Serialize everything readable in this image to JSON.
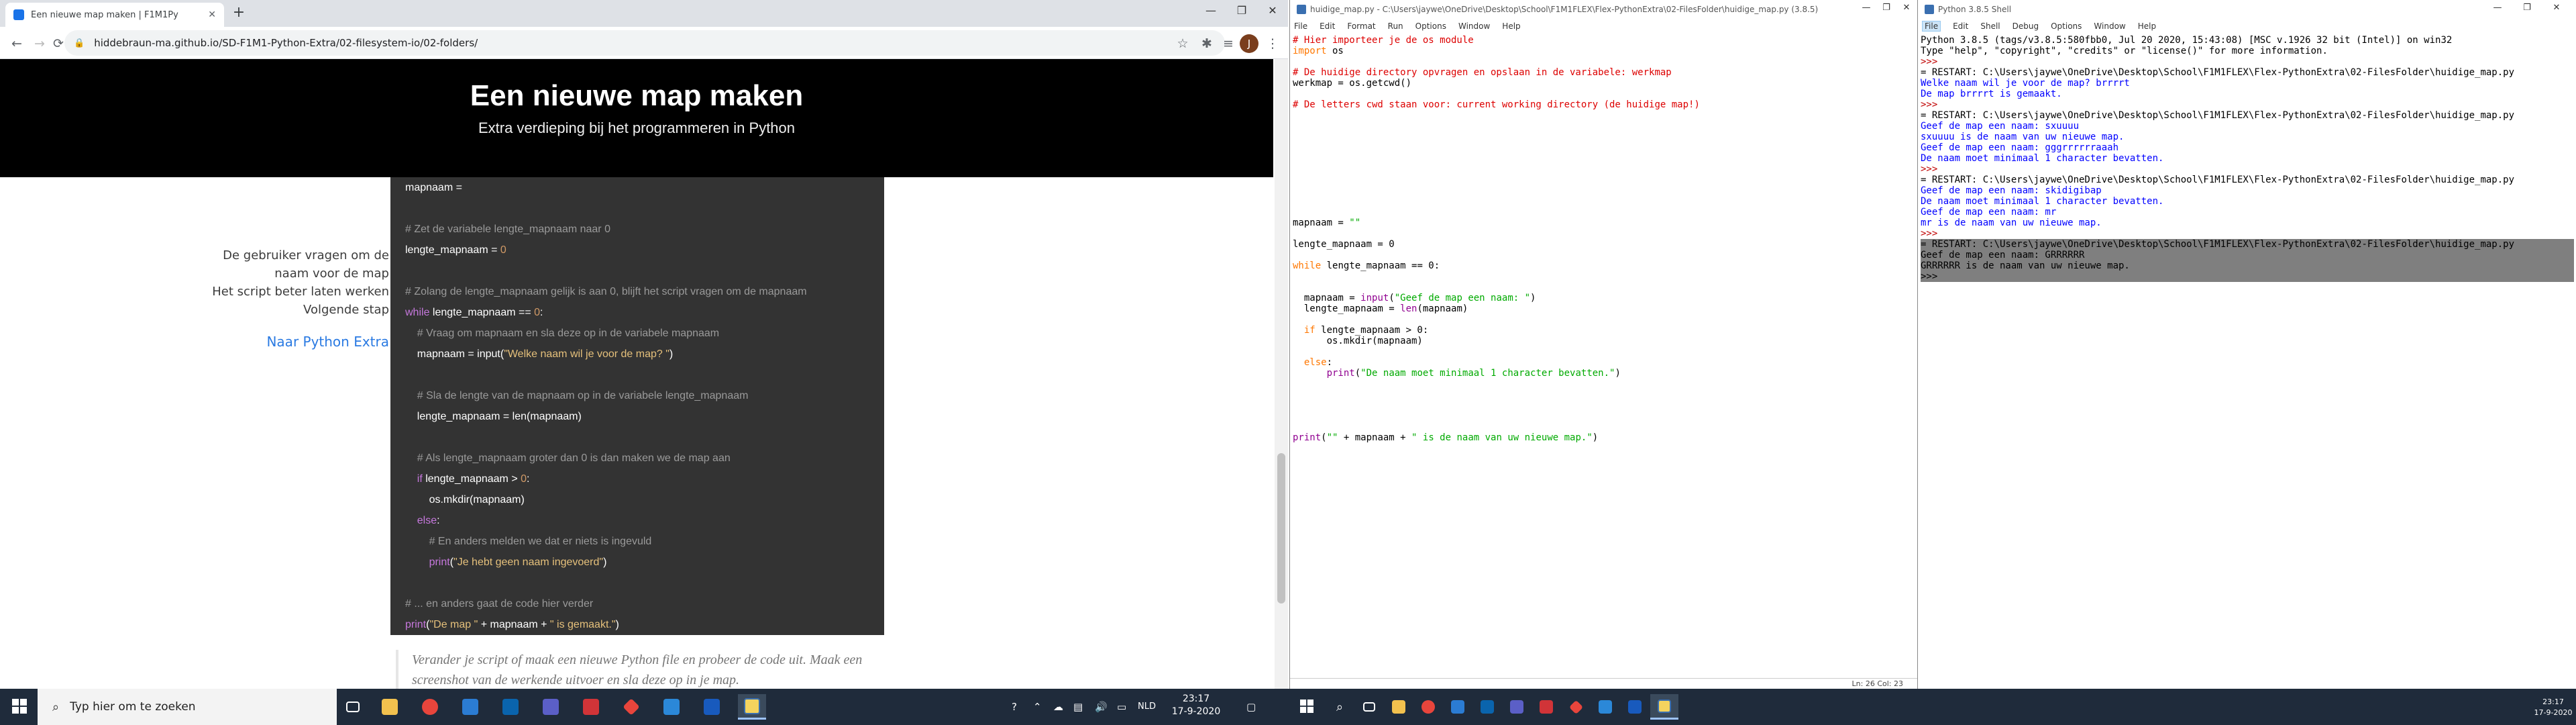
{
  "chrome": {
    "tab_title": "Een nieuwe map maken | F1M1Py",
    "url": "hiddebraun-ma.github.io/SD-F1M1-Python-Extra/02-filesystem-io/02-folders/",
    "avatar_letter": "J",
    "window_controls": [
      "—",
      "❐",
      "✕"
    ],
    "page": {
      "title": "Een nieuwe map maken",
      "subtitle": "Extra verdieping bij het programmeren in Python",
      "toc": [
        "De gebruiker vragen om de",
        "naam voor de map",
        "Het script beter laten werken",
        "Volgende stap"
      ],
      "toc_link": "Naar Python Extra",
      "code_lines": [
        [
          {
            "t": "mapnaam = ",
            "c": "p"
          }
        ],
        [
          {
            "t": "",
            "c": "p"
          }
        ],
        [
          {
            "t": "# Zet de variabele lengte_mapnaam naar 0",
            "c": "com"
          }
        ],
        [
          {
            "t": "lengte_mapnaam = ",
            "c": "p"
          },
          {
            "t": "0",
            "c": "num"
          }
        ],
        [
          {
            "t": "",
            "c": "p"
          }
        ],
        [
          {
            "t": "# Zolang de lengte_mapnaam gelijk is aan 0, blijft het script vragen om de mapnaam",
            "c": "com"
          }
        ],
        [
          {
            "t": "while",
            "c": "kw"
          },
          {
            "t": " lengte_mapnaam == ",
            "c": "p"
          },
          {
            "t": "0",
            "c": "num"
          },
          {
            "t": ":",
            "c": "p"
          }
        ],
        [
          {
            "t": "    # Vraag om mapnaam en sla deze op in de variabele mapnaam",
            "c": "com"
          }
        ],
        [
          {
            "t": "    mapnaam = input(",
            "c": "p"
          },
          {
            "t": "\"Welke naam wil je voor de map? \"",
            "c": "str"
          },
          {
            "t": ")",
            "c": "p"
          }
        ],
        [
          {
            "t": "",
            "c": "p"
          }
        ],
        [
          {
            "t": "    # Sla de lengte van de mapnaam op in de variabele lengte_mapnaam",
            "c": "com"
          }
        ],
        [
          {
            "t": "    lengte_mapnaam = len(mapnaam)",
            "c": "p"
          }
        ],
        [
          {
            "t": "",
            "c": "p"
          }
        ],
        [
          {
            "t": "    # Als lengte_mapnaam groter dan 0 is dan maken we de map aan",
            "c": "com"
          }
        ],
        [
          {
            "t": "    ",
            "c": "p"
          },
          {
            "t": "if",
            "c": "kw"
          },
          {
            "t": " lengte_mapnaam > ",
            "c": "p"
          },
          {
            "t": "0",
            "c": "num"
          },
          {
            "t": ":",
            "c": "p"
          }
        ],
        [
          {
            "t": "        os.mkdir(mapnaam)",
            "c": "p"
          }
        ],
        [
          {
            "t": "    ",
            "c": "p"
          },
          {
            "t": "else",
            "c": "kw"
          },
          {
            "t": ":",
            "c": "p"
          }
        ],
        [
          {
            "t": "        # En anders melden we dat er niets is ingevuld",
            "c": "com"
          }
        ],
        [
          {
            "t": "        ",
            "c": "p"
          },
          {
            "t": "print",
            "c": "kw"
          },
          {
            "t": "(",
            "c": "p"
          },
          {
            "t": "\"Je hebt geen naam ingevoerd\"",
            "c": "str"
          },
          {
            "t": ")",
            "c": "p"
          }
        ],
        [
          {
            "t": "",
            "c": "p"
          }
        ],
        [
          {
            "t": "# ... en anders gaat de code hier verder",
            "c": "com"
          }
        ],
        [
          {
            "t": "print",
            "c": "kw"
          },
          {
            "t": "(",
            "c": "p"
          },
          {
            "t": "\"De map \"",
            "c": "str"
          },
          {
            "t": " + mapnaam + ",
            "c": "p"
          },
          {
            "t": "\" is gemaakt.\"",
            "c": "str"
          },
          {
            "t": ")",
            "c": "p"
          }
        ]
      ],
      "quote": "Verander je script of maak een nieuwe Python file en probeer de code uit. Maak een screenshot van de werkende uitvoer en sla deze op in je map."
    }
  },
  "taskbar_left": {
    "search_placeholder": "Typ hier om te zoeken",
    "lang": "NLD",
    "time": "23:17",
    "date": "17-9-2020"
  },
  "taskbar_right": {
    "time": "23:17",
    "date": "17-9-2020"
  },
  "editor": {
    "title": "huidige_map.py - C:\\Users\\jaywe\\OneDrive\\Desktop\\School\\F1M1FLEX\\Flex-PythonExtra\\02-FilesFolder\\huidige_map.py (3.8.5)",
    "menus": [
      "File",
      "Edit",
      "Format",
      "Run",
      "Options",
      "Window",
      "Help"
    ],
    "status": "Ln: 26   Col: 23",
    "lines": [
      [
        {
          "t": "# Hier importeer je de os module",
          "c": "com"
        }
      ],
      [
        {
          "t": "import",
          "c": "kw"
        },
        {
          "t": " os",
          "c": "p"
        }
      ],
      [
        {
          "t": "",
          "c": "p"
        }
      ],
      [
        {
          "t": "# De huidige directory opvragen en opslaan in de variabele: werkmap",
          "c": "com"
        }
      ],
      [
        {
          "t": "werkmap = os.getcwd()",
          "c": "p"
        }
      ],
      [
        {
          "t": "",
          "c": "p"
        }
      ],
      [
        {
          "t": "# De letters cwd staan voor: current working directory (de huidige map!)",
          "c": "com"
        }
      ],
      [
        {
          "t": "",
          "c": "p"
        }
      ],
      [
        {
          "t": "",
          "c": "p"
        }
      ],
      [
        {
          "t": "",
          "c": "p"
        }
      ],
      [
        {
          "t": "",
          "c": "p"
        }
      ],
      [
        {
          "t": "",
          "c": "p"
        }
      ],
      [
        {
          "t": "",
          "c": "p"
        }
      ],
      [
        {
          "t": "",
          "c": "p"
        }
      ],
      [
        {
          "t": "",
          "c": "p"
        }
      ],
      [
        {
          "t": "",
          "c": "p"
        }
      ],
      [
        {
          "t": "",
          "c": "p"
        }
      ],
      [
        {
          "t": "mapnaam = ",
          "c": "p"
        },
        {
          "t": "\"\"",
          "c": "str"
        }
      ],
      [
        {
          "t": "",
          "c": "p"
        }
      ],
      [
        {
          "t": "lengte_mapnaam = 0",
          "c": "p"
        }
      ],
      [
        {
          "t": "",
          "c": "p"
        }
      ],
      [
        {
          "t": "while",
          "c": "kw"
        },
        {
          "t": " lengte_mapnaam == 0:",
          "c": "p"
        }
      ],
      [
        {
          "t": "",
          "c": "p"
        }
      ],
      [
        {
          "t": "",
          "c": "p"
        }
      ],
      [
        {
          "t": "  mapnaam = ",
          "c": "p"
        },
        {
          "t": "input",
          "c": "bi"
        },
        {
          "t": "(",
          "c": "p"
        },
        {
          "t": "\"Geef de map een naam: \"",
          "c": "str"
        },
        {
          "t": ")",
          "c": "p"
        }
      ],
      [
        {
          "t": "  lengte_mapnaam = ",
          "c": "p"
        },
        {
          "t": "len",
          "c": "bi"
        },
        {
          "t": "(mapnaam)",
          "c": "p"
        }
      ],
      [
        {
          "t": "",
          "c": "p"
        }
      ],
      [
        {
          "t": "  ",
          "c": "p"
        },
        {
          "t": "if",
          "c": "kw"
        },
        {
          "t": " lengte_mapnaam > 0:",
          "c": "p"
        }
      ],
      [
        {
          "t": "      os.mkdir(mapnaam)",
          "c": "p"
        }
      ],
      [
        {
          "t": "",
          "c": "p"
        }
      ],
      [
        {
          "t": "  ",
          "c": "p"
        },
        {
          "t": "else",
          "c": "kw"
        },
        {
          "t": ":",
          "c": "p"
        }
      ],
      [
        {
          "t": "      ",
          "c": "p"
        },
        {
          "t": "print",
          "c": "bi"
        },
        {
          "t": "(",
          "c": "p"
        },
        {
          "t": "\"De naam moet minimaal 1 character bevatten.\"",
          "c": "str"
        },
        {
          "t": ")",
          "c": "p"
        }
      ],
      [
        {
          "t": "",
          "c": "p"
        }
      ],
      [
        {
          "t": "",
          "c": "p"
        }
      ],
      [
        {
          "t": "",
          "c": "p"
        }
      ],
      [
        {
          "t": "",
          "c": "p"
        }
      ],
      [
        {
          "t": "",
          "c": "p"
        }
      ],
      [
        {
          "t": "print",
          "c": "bi"
        },
        {
          "t": "(",
          "c": "p"
        },
        {
          "t": "\"\"",
          "c": "str"
        },
        {
          "t": " + mapnaam + ",
          "c": "p"
        },
        {
          "t": "\" is de naam van uw nieuwe map.\"",
          "c": "str"
        },
        {
          "t": ")",
          "c": "p"
        }
      ]
    ]
  },
  "shell": {
    "title": "Python 3.8.5 Shell",
    "menus": [
      "File",
      "Edit",
      "Shell",
      "Debug",
      "Options",
      "Window",
      "Help"
    ],
    "selected_menu": "File",
    "lines": [
      {
        "t": "Python 3.8.5 (tags/v3.8.5:580fbb0, Jul 20 2020, 15:43:08) [MSC v.1926 32 bit (Intel)] on win32",
        "c": "in"
      },
      {
        "t": "Type \"help\", \"copyright\", \"credits\" or \"license()\" for more information.",
        "c": "in"
      },
      {
        "t": ">>> ",
        "c": "err"
      },
      {
        "t": "= RESTART: C:\\Users\\jaywe\\OneDrive\\Desktop\\School\\F1M1FLEX\\Flex-PythonExtra\\02-FilesFolder\\huidige_map.py",
        "c": "in"
      },
      {
        "t": "Welke naam wil je voor de map? brrrrt",
        "c": "out"
      },
      {
        "t": "De map brrrrt is gemaakt.",
        "c": "out"
      },
      {
        "t": ">>> ",
        "c": "err"
      },
      {
        "t": "= RESTART: C:\\Users\\jaywe\\OneDrive\\Desktop\\School\\F1M1FLEX\\Flex-PythonExtra\\02-FilesFolder\\huidige_map.py",
        "c": "in"
      },
      {
        "t": "Geef de map een naam: sxuuuu",
        "c": "out"
      },
      {
        "t": "sxuuuu is de naam van uw nieuwe map.",
        "c": "out"
      },
      {
        "t": "Geef de map een naam: gggrrrrrraaah",
        "c": "out"
      },
      {
        "t": "De naam moet minimaal 1 character bevatten.",
        "c": "out"
      },
      {
        "t": ">>> ",
        "c": "err"
      },
      {
        "t": "= RESTART: C:\\Users\\jaywe\\OneDrive\\Desktop\\School\\F1M1FLEX\\Flex-PythonExtra\\02-FilesFolder\\huidige_map.py",
        "c": "in"
      },
      {
        "t": "Geef de map een naam: skidigibap",
        "c": "out"
      },
      {
        "t": "De naam moet minimaal 1 character bevatten.",
        "c": "out"
      },
      {
        "t": "Geef de map een naam: mr",
        "c": "out"
      },
      {
        "t": "mr is de naam van uw nieuwe map.",
        "c": "out"
      },
      {
        "t": ">>> ",
        "c": "err"
      },
      {
        "t": "= RESTART: C:\\Users\\jaywe\\OneDrive\\Desktop\\School\\F1M1FLEX\\Flex-PythonExtra\\02-FilesFolder\\huidige_map.py",
        "c": "sel"
      },
      {
        "t": "Geef de map een naam: GRRRRRR",
        "c": "sel"
      },
      {
        "t": "GRRRRRR is de naam van uw nieuwe map.",
        "c": "sel"
      },
      {
        "t": ">>> ",
        "c": "sel"
      }
    ]
  },
  "colors": {
    "taskbar": "#1f2b3b",
    "code_bg": "#333333",
    "header_bg": "#000000",
    "link": "#2a7ae2"
  }
}
